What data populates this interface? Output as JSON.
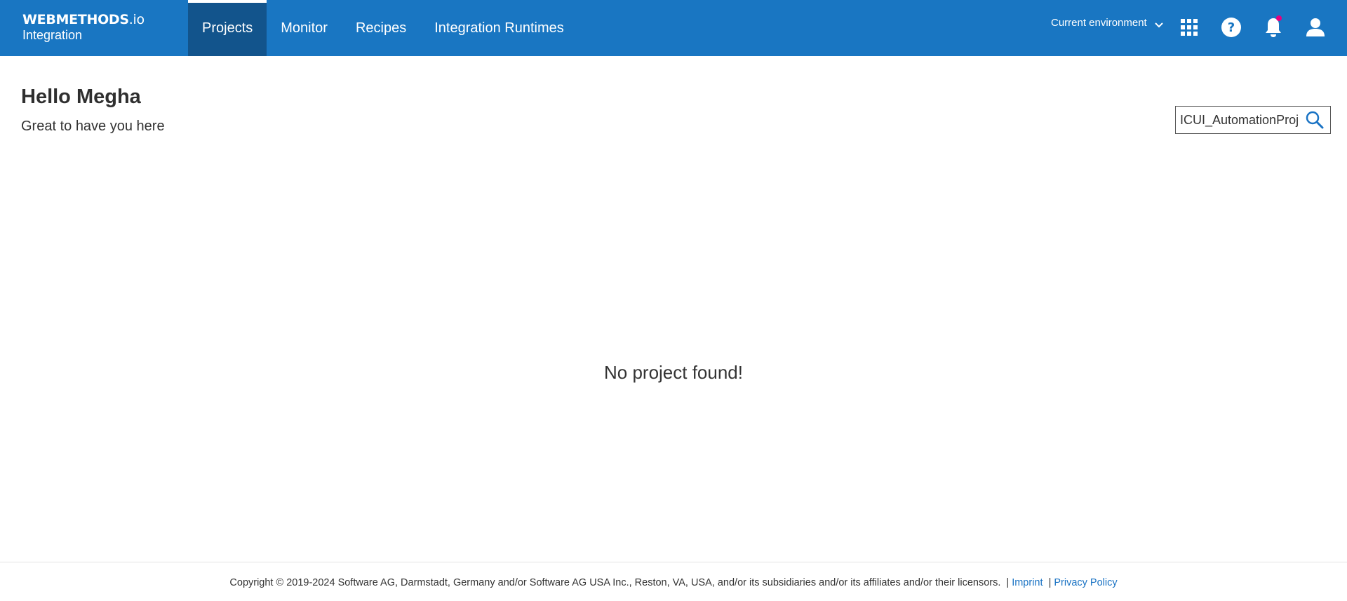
{
  "header": {
    "logo": {
      "brand_bold": "WEBMETHODS",
      "brand_suffix": ".io",
      "product": "Integration"
    },
    "nav_tabs": [
      {
        "label": "Projects",
        "active": true
      },
      {
        "label": "Monitor",
        "active": false
      },
      {
        "label": "Recipes",
        "active": false
      },
      {
        "label": "Integration Runtimes",
        "active": false
      }
    ],
    "environment_label": "Current environment",
    "icons": [
      "apps-grid-icon",
      "help-icon",
      "notification-bell-icon",
      "user-icon"
    ],
    "notification_dot_color": "#e6007e",
    "background_color": "#1976c2",
    "active_tab_color": "#12548c"
  },
  "greeting": {
    "title": "Hello Megha",
    "subtitle": "Great to have you here"
  },
  "search": {
    "value": "ICUI_AutomationProject",
    "icon": "search-icon"
  },
  "main": {
    "empty_message": "No project found!"
  },
  "footer": {
    "copyright": "Copyright © 2019-2024 Software AG, Darmstadt, Germany and/or Software AG USA Inc., Reston, VA, USA, and/or its subsidiaries and/or its affiliates and/or their licensors.",
    "separator": "|",
    "imprint_label": "Imprint",
    "privacy_label": "Privacy Policy",
    "link_color": "#1a73c4"
  }
}
